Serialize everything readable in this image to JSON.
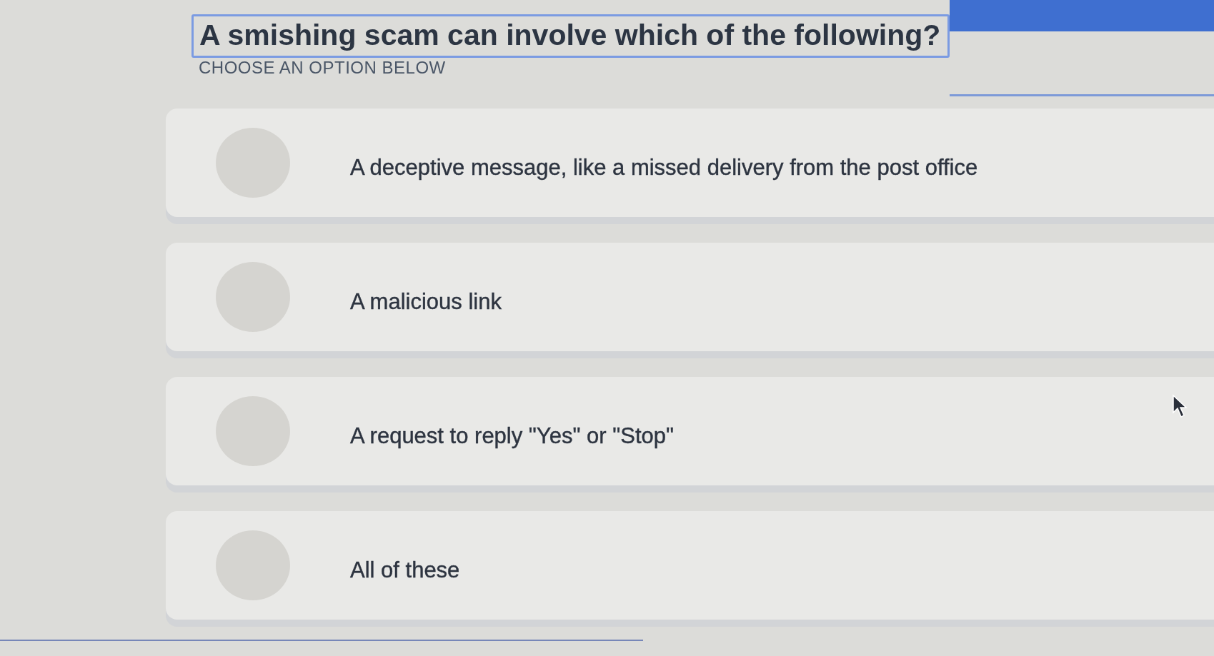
{
  "header": {
    "question": "A smishing scam can involve which of the following?",
    "focused": true,
    "instruction": "CHOOSE AN OPTION BELOW"
  },
  "options": [
    {
      "label": "A deceptive message, like a missed delivery from the post office",
      "selected": false
    },
    {
      "label": "A malicious link",
      "selected": false
    },
    {
      "label": "A request to reply \"Yes\" or \"Stop\"",
      "selected": false
    },
    {
      "label": "All of these",
      "selected": false
    }
  ]
}
